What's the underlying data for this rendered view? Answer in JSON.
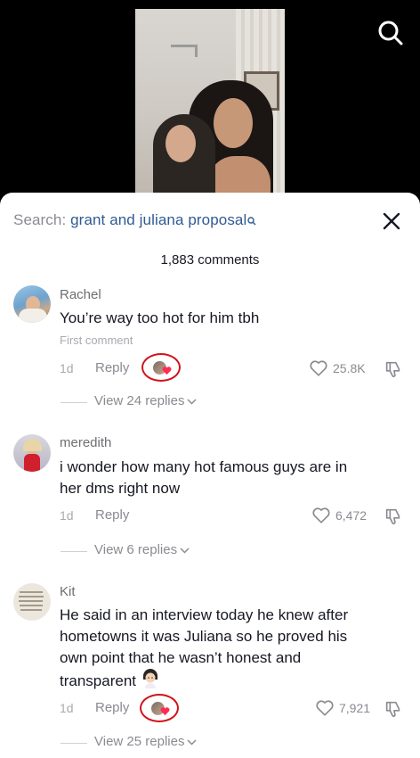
{
  "search": {
    "label": "Search:",
    "query": "grant and juliana proposal"
  },
  "comments_header": {
    "count_label": "1,883 comments"
  },
  "comments": [
    {
      "username": "Rachel",
      "text": "You’re way too hot for him tbh",
      "tag": "First comment",
      "time": "1d",
      "reply_label": "Reply",
      "likes": "25.8K",
      "view_replies": "View 24 replies",
      "creator_liked": true
    },
    {
      "username": "meredith",
      "text_line1": "i wonder how many hot famous guys are in",
      "text_line2": "her dms right now",
      "time": "1d",
      "reply_label": "Reply",
      "likes": "6,472",
      "view_replies": "View 6 replies",
      "creator_liked": false
    },
    {
      "username": "Kit",
      "text_line1": "He said in an interview today he knew after",
      "text_line2": "hometowns it was Juliana so he proved his",
      "text_line3": "own point that he wasn’t honest and",
      "text_line4": "transparent",
      "time": "1d",
      "reply_label": "Reply",
      "likes": "7,921",
      "view_replies": "View 25 replies",
      "creator_liked": true
    }
  ],
  "colors": {
    "query_blue": "#2f5b93",
    "badge_red": "#d0131b",
    "heart_pink": "#fe2c55"
  },
  "icons": [
    "search-icon",
    "close-icon",
    "heart-icon",
    "dislike-icon",
    "chevron-down-icon"
  ]
}
